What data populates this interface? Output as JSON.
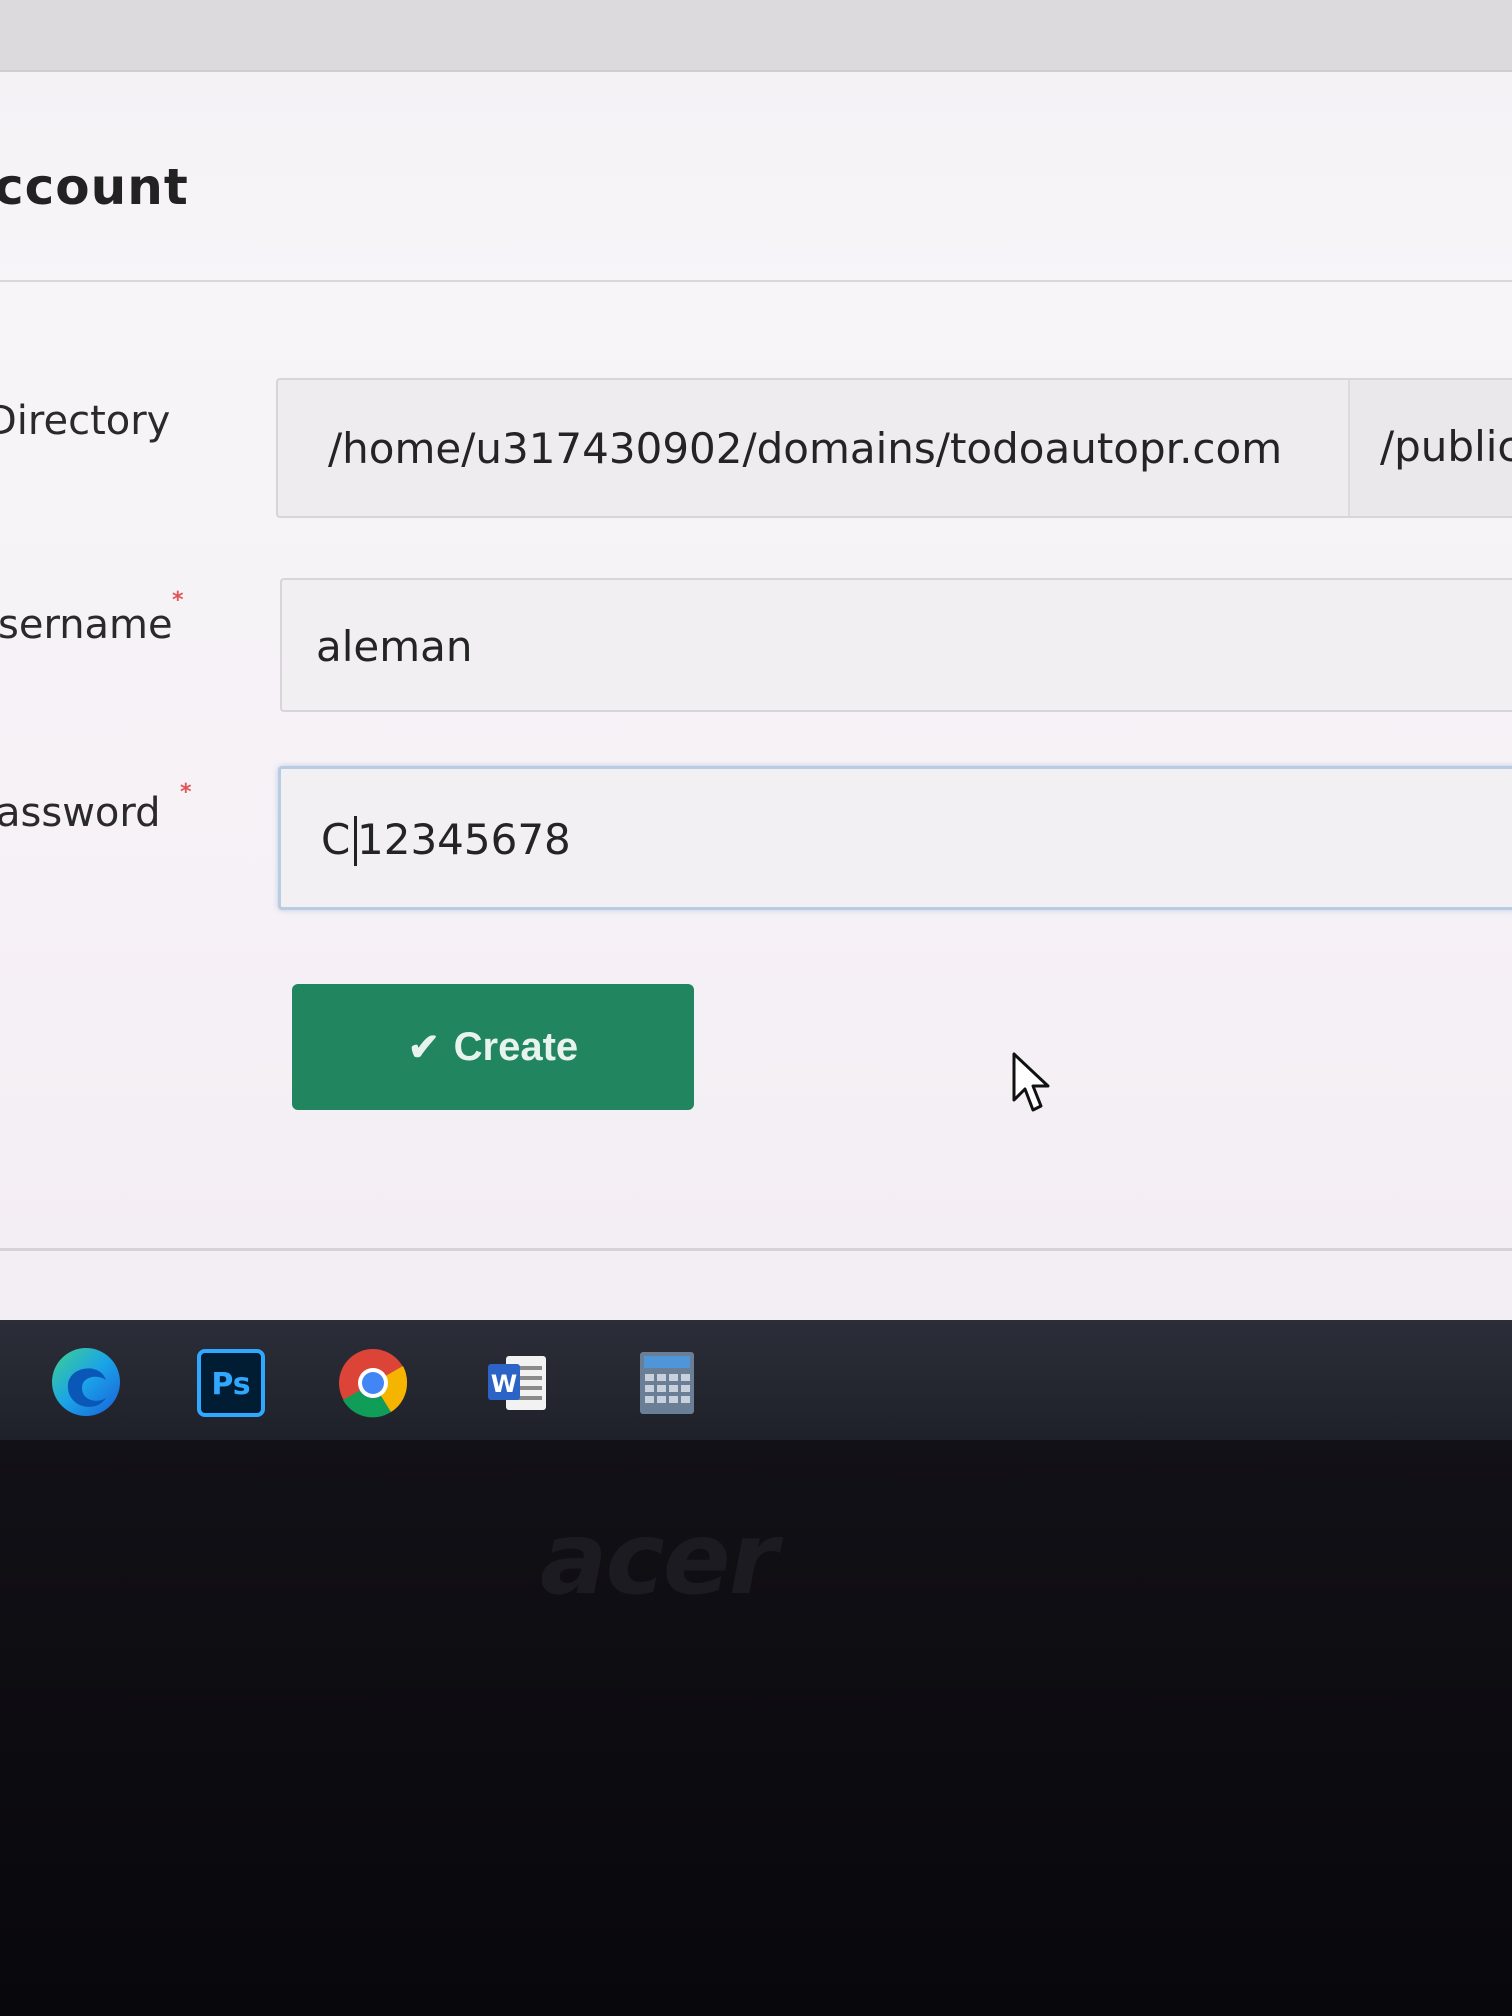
{
  "form": {
    "title": "ccount",
    "fields": {
      "directory": {
        "label": "Directory",
        "value": "/home/u317430902/domains/todoautopr.com",
        "suffix": "/public"
      },
      "username": {
        "label": "sername",
        "required_mark": "*",
        "value": "aleman"
      },
      "password": {
        "label": "assword",
        "required_mark": "*",
        "value_before_caret": "C",
        "value_after_caret": "12345678"
      }
    },
    "create_button": {
      "label": "Create",
      "icon": "check-icon"
    }
  },
  "taskbar": {
    "apps": [
      {
        "name": "Microsoft Edge",
        "icon": "edge-icon"
      },
      {
        "name": "Photoshop",
        "icon": "photoshop-icon",
        "text": "Ps"
      },
      {
        "name": "Chrome",
        "icon": "chrome-icon"
      },
      {
        "name": "Word",
        "icon": "word-icon",
        "text": "W"
      },
      {
        "name": "Calculator",
        "icon": "calculator-icon"
      }
    ]
  },
  "device": {
    "brand": "acer"
  },
  "colors": {
    "accent_button": "#21855f",
    "required": "#e05555",
    "focus_border": "#b9cde2"
  }
}
